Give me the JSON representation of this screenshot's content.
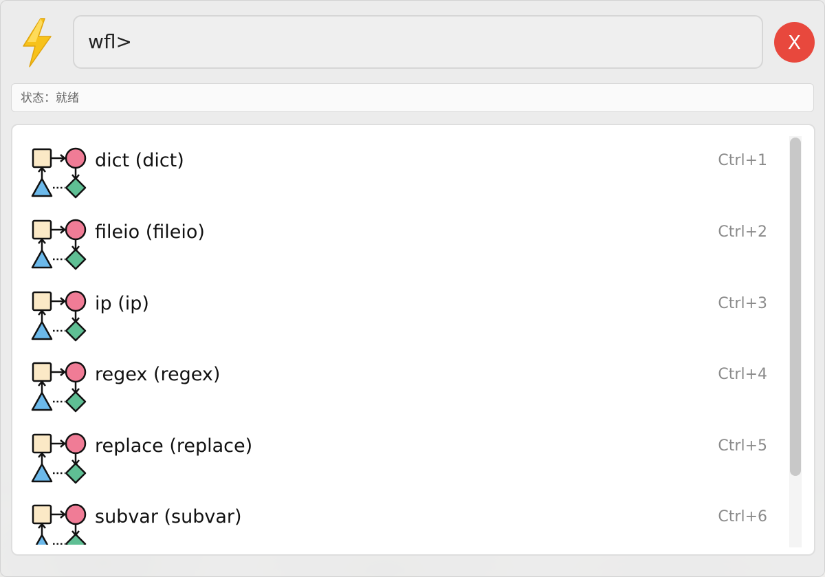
{
  "search": {
    "value": "wfl>"
  },
  "close_button": {
    "label": "X"
  },
  "status": {
    "text": "状态：就绪"
  },
  "results": [
    {
      "label": "dict (dict)",
      "shortcut": "Ctrl+1",
      "icon": "workflow-icon"
    },
    {
      "label": "fileio (fileio)",
      "shortcut": "Ctrl+2",
      "icon": "workflow-icon"
    },
    {
      "label": "ip (ip)",
      "shortcut": "Ctrl+3",
      "icon": "workflow-icon"
    },
    {
      "label": "regex (regex)",
      "shortcut": "Ctrl+4",
      "icon": "workflow-icon"
    },
    {
      "label": "replace (replace)",
      "shortcut": "Ctrl+5",
      "icon": "workflow-icon"
    },
    {
      "label": "subvar (subvar)",
      "shortcut": "Ctrl+6",
      "icon": "workflow-icon"
    }
  ],
  "colors": {
    "close": "#e8483d",
    "logo_bolt": "#f7c21b",
    "icon_square": "#fbe9c6",
    "icon_circle": "#f07c96",
    "icon_triangle": "#6cb9ea",
    "icon_diamond": "#5fbf94"
  }
}
